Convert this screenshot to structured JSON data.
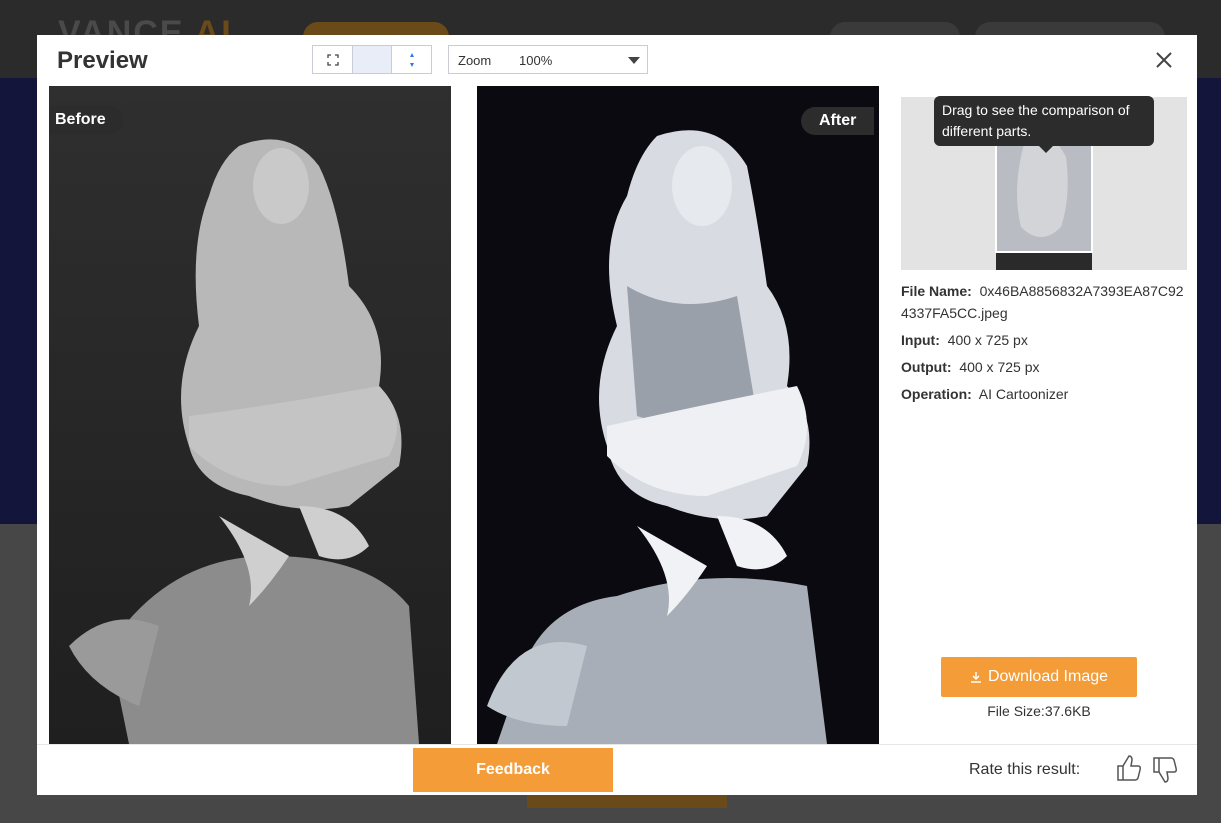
{
  "modal": {
    "title": "Preview",
    "zoom_label": "Zoom",
    "zoom_value": "100%"
  },
  "images": {
    "before_label": "Before",
    "after_label": "After"
  },
  "thumbnail": {
    "tooltip": "Drag to see the comparison of different parts."
  },
  "info": {
    "file_name_label": "File Name:",
    "file_name": "0x46BA8856832A7393EA87C924337FA5CC.jpeg",
    "input_label": "Input:",
    "input": "400 x 725 px",
    "output_label": "Output:",
    "output": "400 x 725 px",
    "operation_label": "Operation:",
    "operation": "AI Cartoonizer"
  },
  "download": {
    "label": "Download Image",
    "file_size": "File Size:37.6KB"
  },
  "footer": {
    "feedback_label": "Feedback",
    "rate_label": "Rate this result:"
  },
  "colors": {
    "accent": "#f39c38",
    "tag_bg": "#2c2c2c"
  }
}
